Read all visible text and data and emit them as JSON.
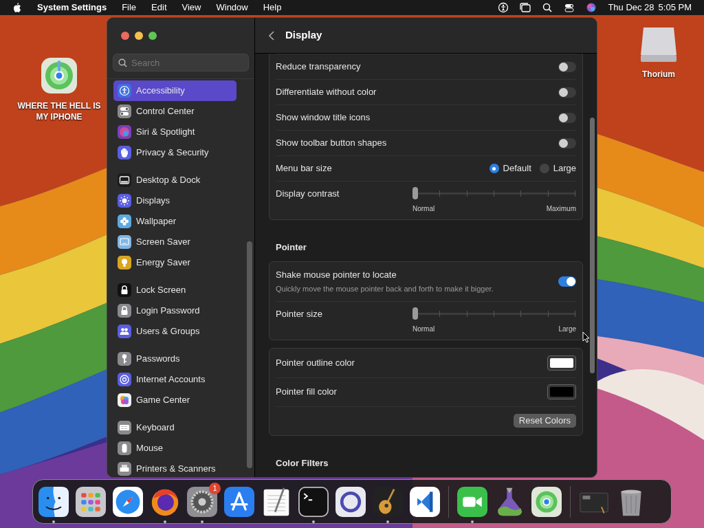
{
  "menu_bar": {
    "app": "System Settings",
    "menus": [
      "File",
      "Edit",
      "View",
      "Window",
      "Help"
    ],
    "date": "Thu Dec 28",
    "time": "5:05 PM"
  },
  "desktop_icons": [
    {
      "label": "WHERE THE HELL IS MY IPHONE",
      "kind": "locator"
    },
    {
      "label": "Thorium",
      "kind": "drive"
    }
  ],
  "window": {
    "title": "Display"
  },
  "sidebar": {
    "search": {
      "placeholder": "Search"
    },
    "groups": [
      [
        {
          "label": "Accessibility",
          "kind": "person",
          "color": "#3f6fe0",
          "selected": true
        },
        {
          "label": "Control Center",
          "kind": "toggles",
          "color": "#8a8a8e",
          "selected": false
        },
        {
          "label": "Siri & Spotlight",
          "kind": "orb",
          "color": "#7a3fb8",
          "selected": false
        },
        {
          "label": "Privacy & Security",
          "kind": "hand",
          "color": "#5a5ee0",
          "selected": false
        }
      ],
      [
        {
          "label": "Desktop & Dock",
          "kind": "dock",
          "color": "#1c1c1e",
          "selected": false
        },
        {
          "label": "Displays",
          "kind": "sun",
          "color": "#5a5ee0",
          "selected": false
        },
        {
          "label": "Wallpaper",
          "kind": "flower",
          "color": "#5fa9e0",
          "selected": false
        },
        {
          "label": "Screen Saver",
          "kind": "screen",
          "color": "#7fb6e6",
          "selected": false
        },
        {
          "label": "Energy Saver",
          "kind": "bulb",
          "color": "#d9a521",
          "selected": false
        }
      ],
      [
        {
          "label": "Lock Screen",
          "kind": "lock",
          "color": "#111111",
          "selected": false
        },
        {
          "label": "Login Password",
          "kind": "lock",
          "color": "#8a8a8e",
          "selected": false
        },
        {
          "label": "Users & Groups",
          "kind": "people",
          "color": "#5a5ee0",
          "selected": false
        }
      ],
      [
        {
          "label": "Passwords",
          "kind": "key",
          "color": "#8a8a8e",
          "selected": false
        },
        {
          "label": "Internet Accounts",
          "kind": "at",
          "color": "#5a5ee0",
          "selected": false
        },
        {
          "label": "Game Center",
          "kind": "bubbles",
          "color": "#f2f2f2",
          "selected": false
        }
      ],
      [
        {
          "label": "Keyboard",
          "kind": "keyboard",
          "color": "#8a8a8e",
          "selected": false
        },
        {
          "label": "Mouse",
          "kind": "mouse",
          "color": "#8a8a8e",
          "selected": false
        },
        {
          "label": "Printers & Scanners",
          "kind": "printer",
          "color": "#8a8a8e",
          "selected": false
        }
      ]
    ]
  },
  "sections": [
    {
      "cards": [
        {
          "rows": [
            {
              "kind": "toggle",
              "label": "Reduce transparency",
              "on": false
            },
            {
              "kind": "toggle",
              "label": "Differentiate without color",
              "on": false
            },
            {
              "kind": "toggle",
              "label": "Show window title icons",
              "on": false
            },
            {
              "kind": "toggle",
              "label": "Show toolbar button shapes",
              "on": false
            },
            {
              "kind": "radio",
              "label": "Menu bar size",
              "options": [
                {
                  "label": "Default",
                  "selected": true
                },
                {
                  "label": "Large",
                  "selected": false
                }
              ]
            },
            {
              "kind": "slider",
              "label": "Display contrast",
              "level": 0,
              "min_label": "Normal",
              "max_label": "Maximum"
            }
          ]
        }
      ]
    },
    {
      "heading": "Pointer",
      "cards": [
        {
          "rows": [
            {
              "kind": "toggle",
              "label": "Shake mouse pointer to locate",
              "description": "Quickly move the mouse pointer back and forth to make it bigger.",
              "on": true
            },
            {
              "kind": "slider",
              "label": "Pointer size",
              "level": 0,
              "min_label": "Normal",
              "max_label": "Large"
            }
          ]
        },
        {
          "rows": [
            {
              "kind": "color",
              "label": "Pointer outline color",
              "color": "#ffffff"
            },
            {
              "kind": "color",
              "label": "Pointer fill color",
              "color": "#000000"
            },
            {
              "kind": "button",
              "label": "Reset Colors"
            }
          ]
        }
      ]
    },
    {
      "heading": "Color Filters"
    }
  ],
  "dock": [
    {
      "kind": "finder",
      "running": true
    },
    {
      "kind": "launchpad",
      "running": false
    },
    {
      "kind": "safari",
      "running": false
    },
    {
      "kind": "firefox",
      "running": true
    },
    {
      "kind": "settings",
      "running": true,
      "badge": "1"
    },
    {
      "kind": "appstore",
      "running": false
    },
    {
      "kind": "textedit",
      "running": false
    },
    {
      "kind": "terminal",
      "running": true
    },
    {
      "kind": "circle",
      "running": false
    },
    {
      "kind": "guitar",
      "running": true
    },
    {
      "kind": "vscode",
      "running": false
    },
    {
      "kind": "divider"
    },
    {
      "kind": "facetime",
      "running": true
    },
    {
      "kind": "flask",
      "running": false
    },
    {
      "kind": "locator",
      "running": false
    },
    {
      "kind": "divider"
    },
    {
      "kind": "window",
      "running": false
    },
    {
      "kind": "trash",
      "running": false
    }
  ]
}
